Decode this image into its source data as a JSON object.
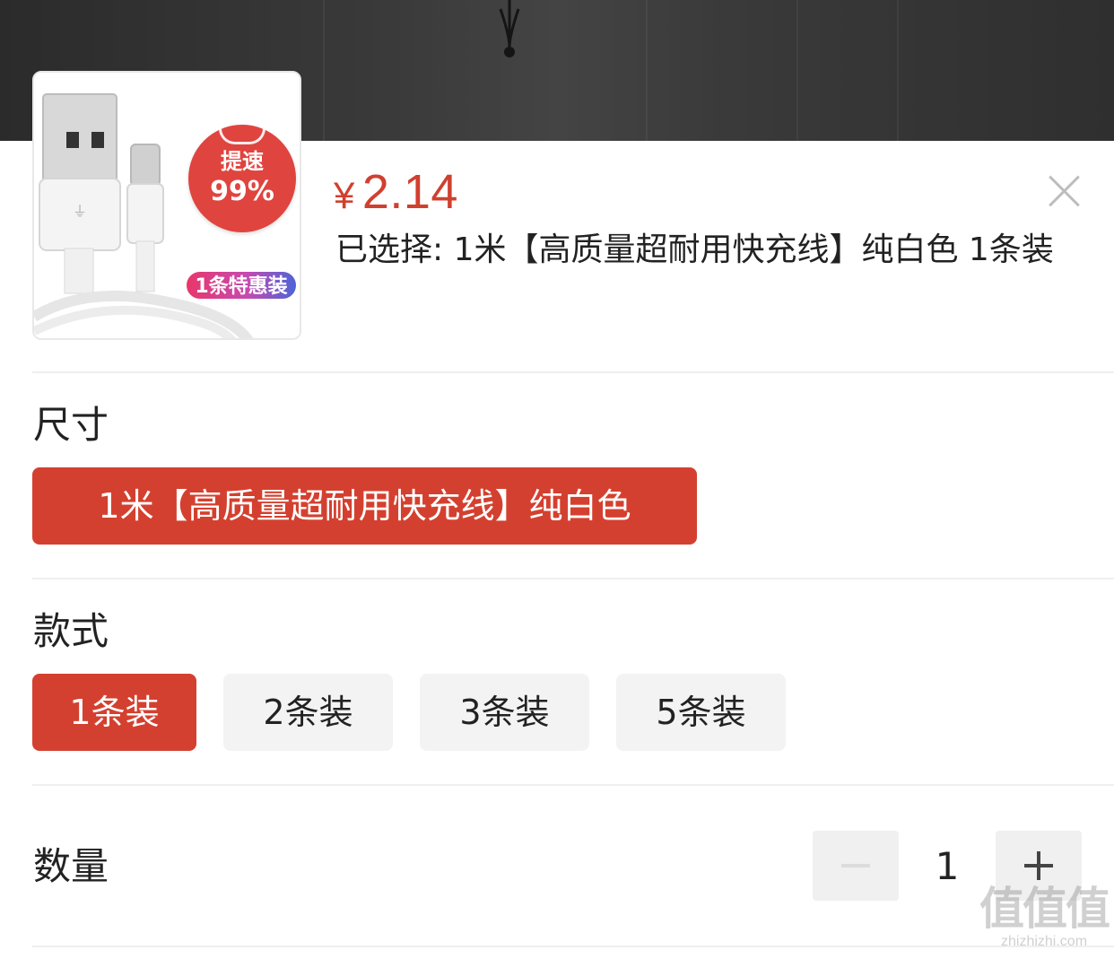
{
  "product": {
    "price_symbol": "¥",
    "price": "2.14",
    "selected_text": "已选择: 1米【高质量超耐用快充线】纯白色 1条装",
    "thumbnail": {
      "badge_speed_line1": "提速",
      "badge_speed_line2": "99%",
      "badge_pack": "1条特惠装"
    }
  },
  "sections": {
    "size": {
      "title": "尺寸",
      "options": [
        {
          "label": "1米【高质量超耐用快充线】纯白色",
          "selected": true
        }
      ]
    },
    "style": {
      "title": "款式",
      "options": [
        {
          "label": "1条装",
          "selected": true
        },
        {
          "label": "2条装",
          "selected": false
        },
        {
          "label": "3条装",
          "selected": false
        },
        {
          "label": "5条装",
          "selected": false
        }
      ]
    },
    "quantity": {
      "title": "数量",
      "value": "1",
      "minus_disabled": true
    }
  },
  "icons": {
    "close": "close-icon",
    "minus": "minus-icon",
    "plus": "plus-icon"
  },
  "colors": {
    "accent": "#d4402f",
    "price": "#d0402f",
    "chip_bg": "#f3f3f3",
    "disabled_icon": "#dcdcdc",
    "enabled_icon": "#444444"
  },
  "watermark": {
    "logo": "值值值",
    "url": "zhizhizhi.com"
  }
}
